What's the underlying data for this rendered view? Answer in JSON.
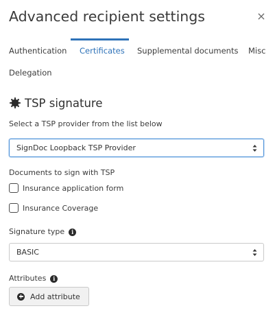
{
  "dialog": {
    "title": "Advanced recipient settings",
    "close_symbol": "×"
  },
  "tabs": [
    {
      "label": "Authentication",
      "active": false
    },
    {
      "label": "Certificates",
      "active": true
    },
    {
      "label": "Supplemental documents",
      "active": false
    },
    {
      "label": "Misc",
      "active": false
    },
    {
      "label": "Delegation",
      "active": false
    }
  ],
  "tsp": {
    "heading": "TSP signature",
    "heading_icon": "gear-icon",
    "provider_label": "Select a TSP provider from the list below",
    "provider_value": "SignDoc Loopback TSP Provider",
    "documents_label": "Documents to sign with TSP",
    "documents": [
      {
        "label": "Insurance application form",
        "checked": false
      },
      {
        "label": "Insurance Coverage",
        "checked": false
      }
    ],
    "signature_type_label": "Signature type",
    "signature_type_value": "BASIC",
    "attributes_label": "Attributes",
    "add_attribute_label": "Add attribute"
  },
  "colors": {
    "accent": "#2e72b8",
    "focus_border": "#4a90d9",
    "text": "#333333"
  }
}
